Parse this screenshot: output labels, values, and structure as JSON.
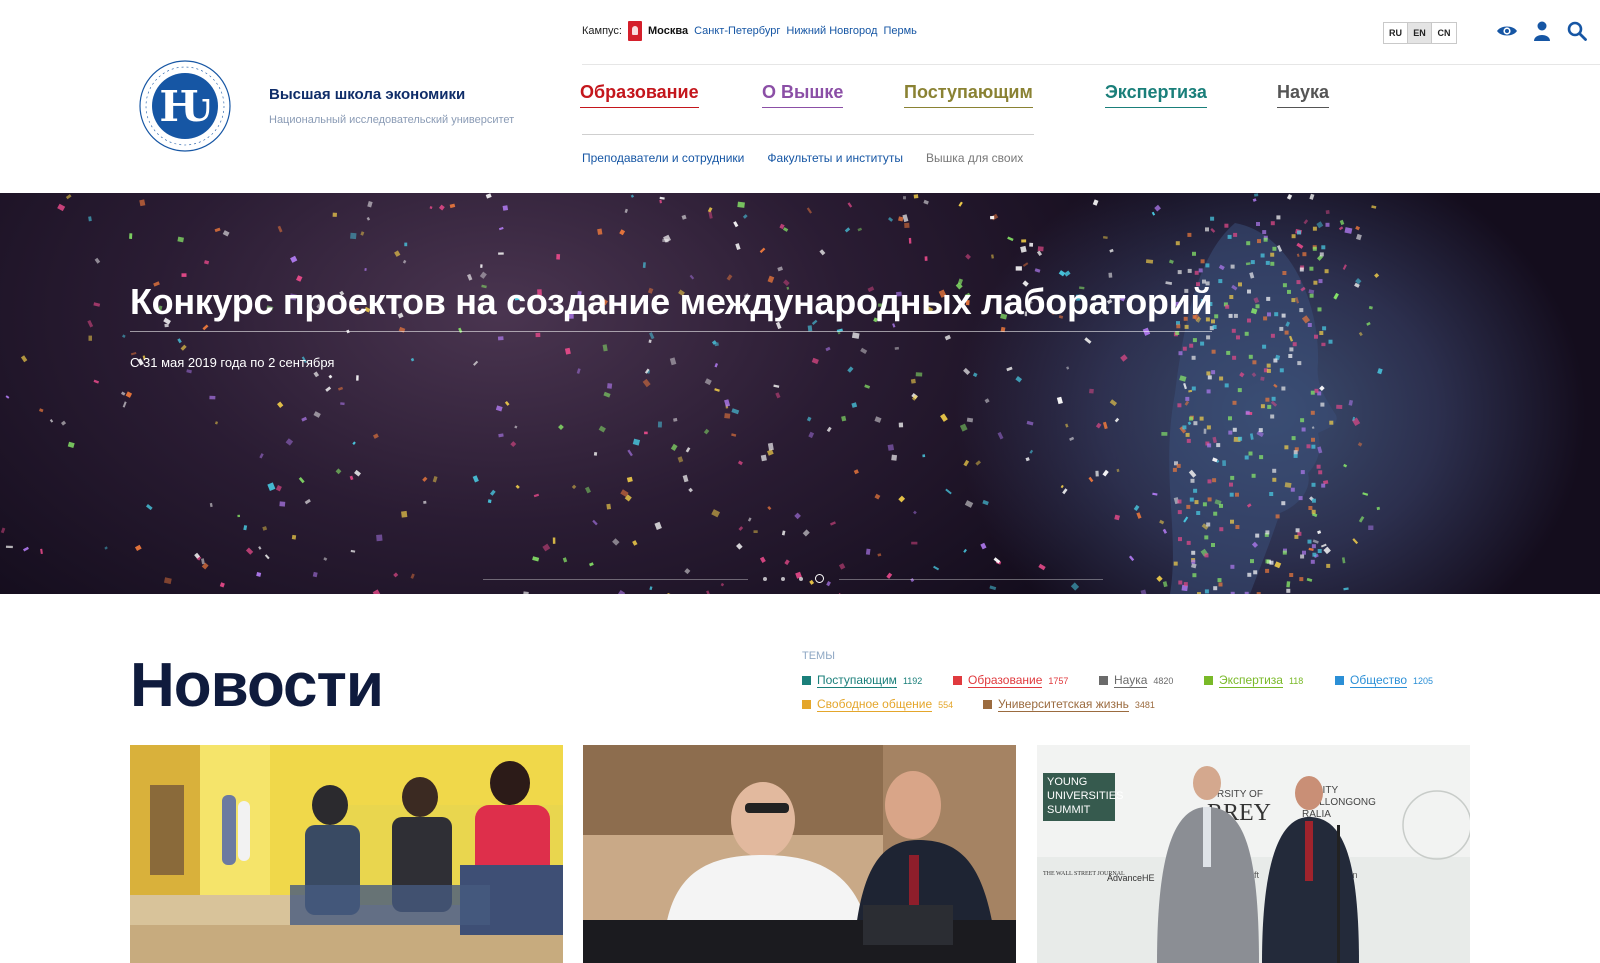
{
  "header": {
    "brand_title": "Высшая школа экономики",
    "brand_subtitle": "Национальный исследовательский университет",
    "campus_label": "Кампус:",
    "campus_current": "Москва",
    "campus_links": [
      "Санкт-Петербург",
      "Нижний Новгород",
      "Пермь"
    ],
    "languages": [
      "RU",
      "EN",
      "CN"
    ],
    "active_language": "EN",
    "icons": [
      "eye-icon",
      "user-icon",
      "search-icon"
    ]
  },
  "main_nav": [
    {
      "label": "Образование",
      "color": "#c4161c"
    },
    {
      "label": "О Вышке",
      "color": "#8b4fa6"
    },
    {
      "label": "Поступающим",
      "color": "#8a8233"
    },
    {
      "label": "Экспертиза",
      "color": "#1a7f7a"
    },
    {
      "label": "Наука",
      "color": "#555555"
    }
  ],
  "sub_nav": [
    "Преподаватели и сотрудники",
    "Факультеты и институты",
    "Вышка для своих"
  ],
  "banner": {
    "title": "Конкурс проектов на создание международных лабораторий",
    "date": "С 31 мая 2019 года по 2 сентября"
  },
  "news": {
    "title": "Новости",
    "themes_label": "ТЕМЫ",
    "themes": [
      {
        "label": "Поступающим",
        "count": "1192",
        "color": "#1a7f7a"
      },
      {
        "label": "Образование",
        "count": "1757",
        "color": "#e03a3e"
      },
      {
        "label": "Наука",
        "count": "4820",
        "color": "#6b6b6b"
      },
      {
        "label": "Экспертиза",
        "count": "118",
        "color": "#79b928"
      },
      {
        "label": "Общество",
        "count": "1205",
        "color": "#2b8fd6"
      },
      {
        "label": "Свободное общение",
        "count": "554",
        "color": "#e4a62b"
      },
      {
        "label": "Университетская жизнь",
        "count": "3481",
        "color": "#9b6b3f"
      }
    ],
    "card3_text": {
      "summit_line1": "YOUNG",
      "summit_line2": "UNIVERSITIES",
      "summit_line3": "SUMMIT",
      "surrey": "RREY",
      "uni_of": "RSITY OF",
      "wollongong": "ERSITY",
      "wollongong2": "WOLLONGONG",
      "australia": "RALIA",
      "wsj": "THE WALL STREET JOURNAL",
      "advance": "AdvanceHE",
      "microsoft": "crosoft",
      "pearson": "rson"
    }
  }
}
